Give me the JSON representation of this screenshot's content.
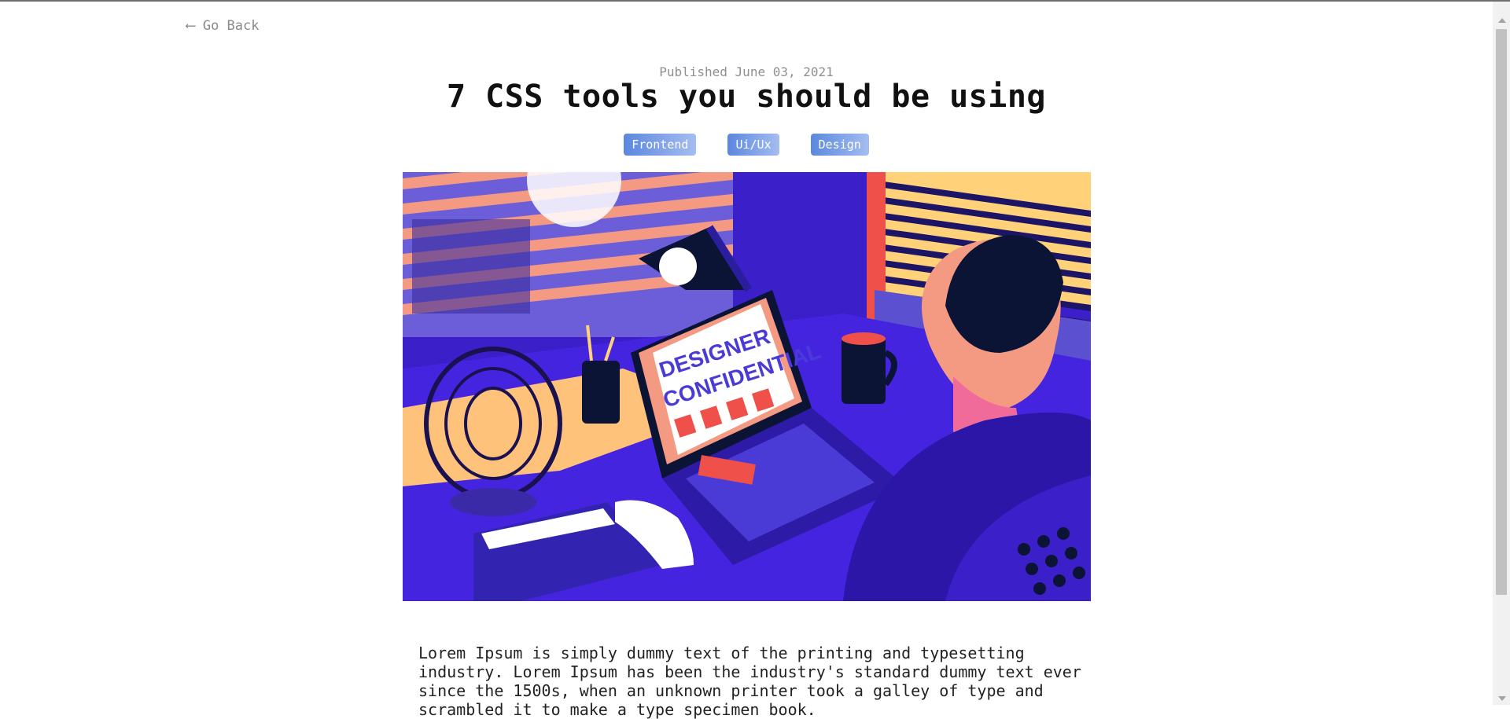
{
  "nav": {
    "back_label": "Go Back",
    "back_icon": "arrow-left-icon"
  },
  "article": {
    "published": "Published June 03, 2021",
    "title": "7 CSS tools you should be using",
    "tags": [
      "Frontend",
      "Ui/Ux",
      "Design"
    ],
    "hero": {
      "screen_line1": "DESIGNER",
      "screen_line2": "CONFIDENTIAL"
    },
    "body": "Lorem Ipsum is simply dummy text of the printing and typesetting industry. Lorem Ipsum has been the industry's standard dummy text ever since the 1500s, when an unknown printer took a galley of type and scrambled it to make a type specimen book."
  },
  "colors": {
    "tag_start": "#5b87df",
    "tag_end": "#a5bdf0",
    "hero_indigo": "#3f1fd6",
    "hero_navy": "#0c1436",
    "hero_salmon": "#f49a82",
    "hero_cream": "#ffd27a"
  }
}
